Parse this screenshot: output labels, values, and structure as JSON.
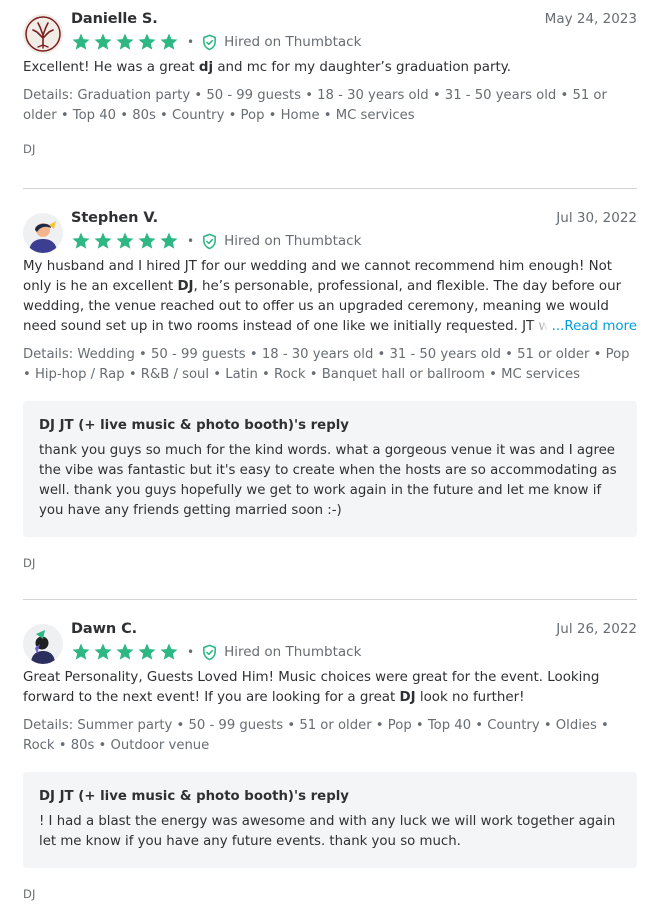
{
  "colors": {
    "star": "#2db783",
    "verified": "#2db783",
    "link": "#009fd9",
    "muted": "#676d73"
  },
  "reviews": [
    {
      "avatar": "tree-logo-avatar",
      "name": "Danielle S.",
      "date": "May 24, 2023",
      "rating": 5,
      "separator": "•",
      "hired": "Hired on Thumbtack",
      "text_parts": [
        "Excellent! He was a great ",
        "dj",
        " and mc for my daughter’s graduation party."
      ],
      "details": "Details: Graduation party • 50 - 99 guests • 18 - 30 years old • 31 - 50 years old • 51 or older • Top 40 • 80s • Country • Pop • Home • MC services",
      "tag": "DJ"
    },
    {
      "avatar": "person-avatar",
      "name": "Stephen V.",
      "date": "Jul 30, 2022",
      "rating": 5,
      "separator": "•",
      "hired": "Hired on Thumbtack",
      "text_parts": [
        "My husband and I hired JT for our wedding and we cannot recommend him enough! Not only is he an excellent ",
        "DJ",
        ", he’s personable, professional, and flexible. The day before our wedding, the venue reached out to offer us an upgraded ceremony, meaning we would need sound set up in two rooms instead of one like we initially requested. JT was"
      ],
      "read_more": "...Read more",
      "details": "Details: Wedding • 50 - 99 guests • 18 - 30 years old • 31 - 50 years old • 51 or older • Pop • Hip-hop / Rap • R&B / soul • Latin • Rock • Banquet hall or ballroom • MC services",
      "reply_title": "DJ JT (+ live music & photo booth)'s reply",
      "reply_text": "thank you guys so much for the kind words. what a gorgeous venue it was and I agree the vibe was fantastic but it's easy to create when the hosts are so accommodating as well. thank you guys hopefully we get to work again in the future and let me know if you have any friends getting married soon :-)",
      "tag": "DJ"
    },
    {
      "avatar": "person-avatar",
      "name": "Dawn C.",
      "date": "Jul 26, 2022",
      "rating": 5,
      "separator": "•",
      "hired": "Hired on Thumbtack",
      "text_parts": [
        "Great Personality, Guests Loved Him! Music choices were great for the event. Looking forward to the next event! If you are looking for a great ",
        "DJ",
        " look no further!"
      ],
      "details": "Details: Summer party • 50 - 99 guests • 51 or older • Pop • Top 40 • Country • Oldies • Rock • 80s • Outdoor venue",
      "reply_title": "DJ JT (+ live music & photo booth)'s reply",
      "reply_text": "! I had a blast the energy was awesome and with any luck we will work together again let me know if you have any future events. thank you so much.",
      "tag": "DJ"
    }
  ]
}
